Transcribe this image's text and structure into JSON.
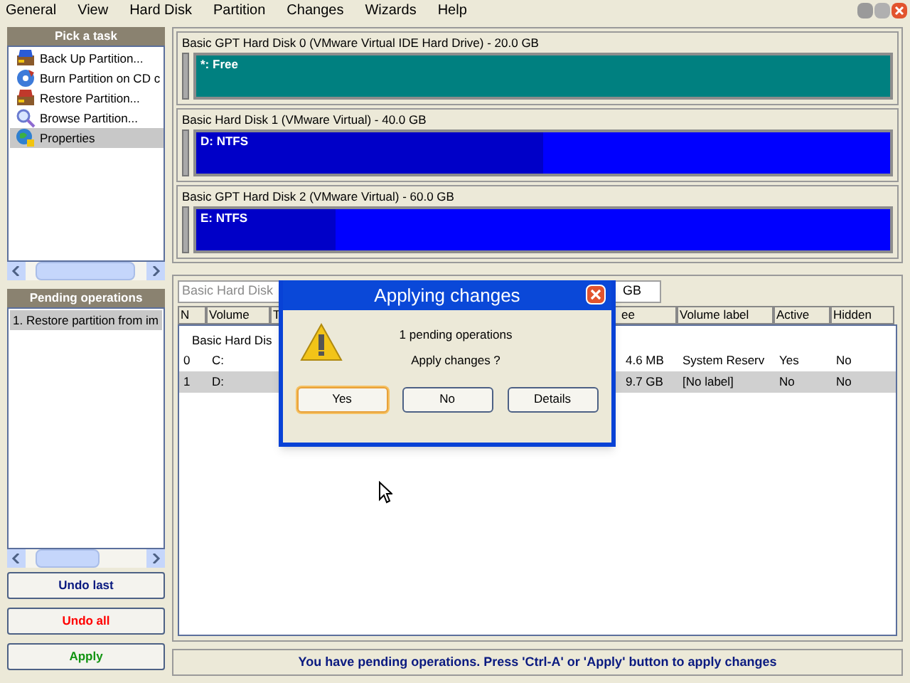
{
  "menu": [
    "General",
    "View",
    "Hard Disk",
    "Partition",
    "Changes",
    "Wizards",
    "Help"
  ],
  "tasks": {
    "title": "Pick a task",
    "items": [
      {
        "label": "Back Up Partition...",
        "kind": "backup",
        "selected": false
      },
      {
        "label": "Burn Partition on CD c",
        "kind": "burn",
        "selected": false
      },
      {
        "label": "Restore Partition...",
        "kind": "restore",
        "selected": false
      },
      {
        "label": "Browse Partition...",
        "kind": "browse",
        "selected": false
      },
      {
        "label": "Properties",
        "kind": "properties",
        "selected": true
      }
    ]
  },
  "pending": {
    "title": "Pending operations",
    "items": [
      {
        "label": "1. Restore partition from im",
        "selected": true
      }
    ]
  },
  "actions": [
    {
      "label": "Undo last",
      "kind": "undo_last"
    },
    {
      "label": "Undo all",
      "kind": "undo_all"
    },
    {
      "label": "Apply",
      "kind": "apply"
    }
  ],
  "disks": [
    {
      "title": "Basic GPT Hard Disk 0 (VMware Virtual IDE Hard Drive) - 20.0 GB",
      "partition": "*: Free",
      "kind": "free"
    },
    {
      "title": "Basic Hard Disk 1 (VMware Virtual) - 40.0 GB",
      "partition": "D: NTFS",
      "kind": "ntfs",
      "level": 0.5
    },
    {
      "title": "Basic GPT Hard Disk 2 (VMware Virtual) - 60.0 GB",
      "partition": "E: NTFS",
      "kind": "ntfs",
      "level": 0.2
    }
  ],
  "volumes": {
    "selector": [
      "Basic Hard Disk",
      "GB"
    ],
    "columns": [
      "N",
      "Volume",
      "T",
      "ee",
      "Volume label",
      "Active",
      "Hidden"
    ],
    "group": "Basic Hard Dis",
    "rows": [
      {
        "cells": [
          "0",
          "C:",
          "",
          "4.6 MB",
          "System Reserv",
          "Yes",
          "No"
        ],
        "selected": false
      },
      {
        "cells": [
          "1",
          "D:",
          "",
          "9.7 GB",
          "[No label]",
          "No",
          "No"
        ],
        "selected": true
      }
    ]
  },
  "dialog": {
    "title": "Applying changes",
    "lines": [
      "1 pending operations",
      "Apply changes ?"
    ],
    "buttons": [
      {
        "label": "Yes",
        "focused": true
      },
      {
        "label": "No",
        "focused": false
      },
      {
        "label": "Details",
        "focused": false
      }
    ]
  },
  "status_bar": "You have pending operations. Press 'Ctrl-A' or 'Apply' button to apply changes"
}
